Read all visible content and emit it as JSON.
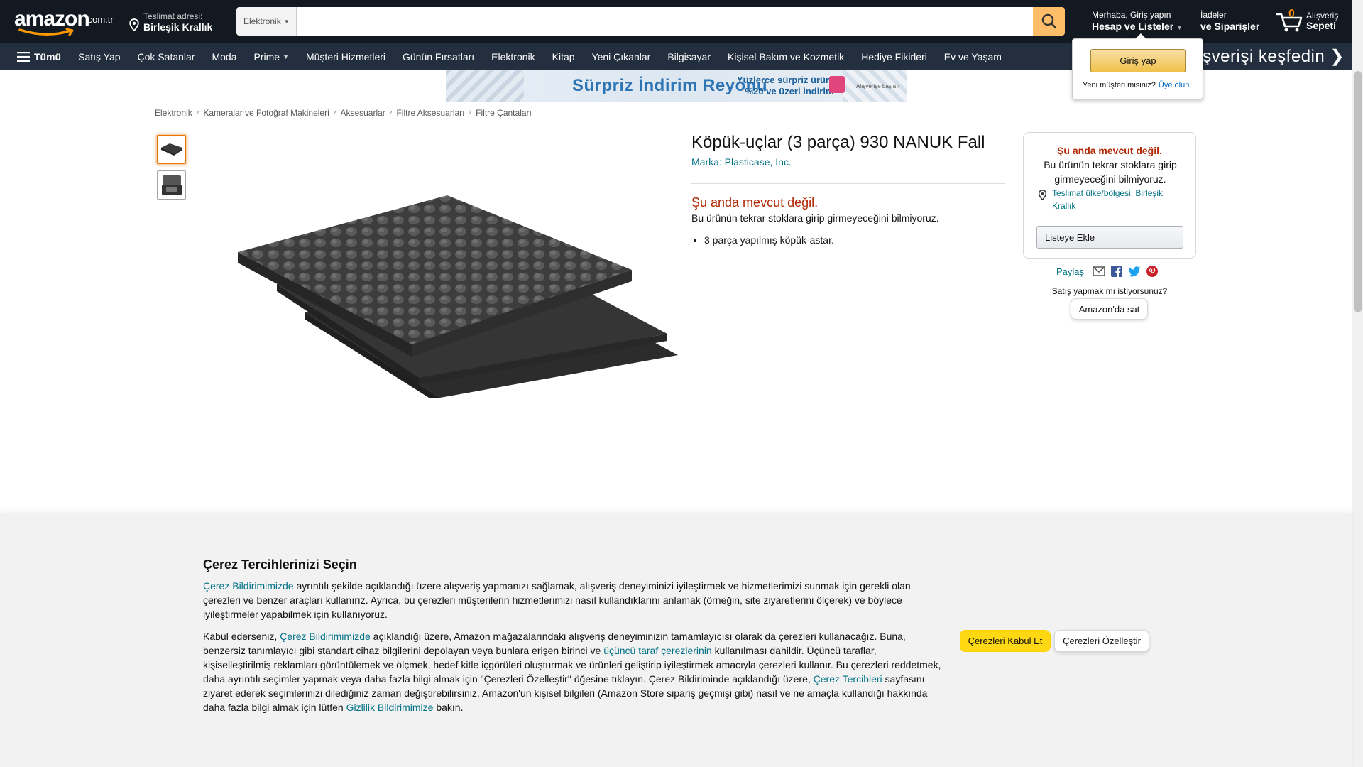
{
  "header": {
    "logo_text": "amazon",
    "logo_tld": ".com.tr",
    "deliver_label": "Teslimat adresi:",
    "deliver_location": "Birleşik Krallık",
    "search_category": "Elektronik",
    "search_value": "",
    "account_greeting": "Merhaba, Giriş yapın",
    "account_label": "Hesap ve Listeler",
    "orders_line1": "İadeler",
    "orders_line2": "ve Siparişler",
    "cart_count": "0",
    "cart_line1": "Alışveriş",
    "cart_line2": "Sepeti"
  },
  "nav": {
    "all_label": "Tümü",
    "items": [
      {
        "label": "Satış Yap"
      },
      {
        "label": "Çok Satanlar"
      },
      {
        "label": "Moda"
      },
      {
        "label": "Prime"
      },
      {
        "label": "Müşteri Hizmetleri"
      },
      {
        "label": "Günün Fırsatları"
      },
      {
        "label": "Elektronik"
      },
      {
        "label": "Kitap"
      },
      {
        "label": "Yeni Çıkanlar"
      },
      {
        "label": "Bilgisayar"
      },
      {
        "label": "Kişisel Bakım ve Kozmetik"
      },
      {
        "label": "Hediye Fikirleri"
      },
      {
        "label": "Ev ve Yaşam"
      }
    ],
    "promo_text": "alışverişi keşfedin ❯"
  },
  "signin_flyout": {
    "button_label": "Giriş yap",
    "new_customer_text": "Yeni müşteri misiniz?",
    "register_link": "Üye olun."
  },
  "banner": {
    "title": "Sürpriz İndirim Reyonu",
    "subtitle_line1": "Yüzlerce sürpriz üründe",
    "subtitle_line2": "%20 ve üzeri indirim",
    "small_text": "Alışverişe başla ›"
  },
  "breadcrumb": [
    "Elektronik",
    "Kameralar ve Fotoğraf Makineleri",
    "Aksesuarlar",
    "Filtre Aksesuarları",
    "Filtre Çantaları"
  ],
  "product": {
    "title": "Köpük-uçlar (3 parça) 930 NANUK Fall",
    "brand": "Marka: Plasticase, Inc.",
    "availability_title": "Şu anda mevcut değil.",
    "availability_text": "Bu ürünün tekrar stoklara girip girmeyeceğini bilmiyoruz.",
    "bullets": [
      "3 parça yapılmış köpük-astar."
    ]
  },
  "buybox": {
    "title": "Şu anda mevcut değil.",
    "text": "Bu ürünün tekrar stoklara girip girmeyeceğini bilmiyoruz.",
    "location_link": "Teslimat ülke/bölgesi: Birleşik Krallık",
    "list_button": "Listeye Ekle",
    "share_label": "Paylaş",
    "sell_question": "Satış yapmak mı istiyorsunuz?",
    "sell_button": "Amazon'da sat"
  },
  "cookie": {
    "title": "Çerez Tercihlerinizi Seçin",
    "p1_link": "Çerez Bildirimimizde",
    "p1_text": " ayrıntılı şekilde açıklandığı üzere alışveriş yapmanızı sağlamak, alışveriş deneyiminizi iyileştirmek ve hizmetlerimizi sunmak için gerekli olan çerezleri ve benzer araçları kullanırız. Ayrıca, bu çerezleri müşterilerin hizmetlerimizi nasıl kullandıklarını anlamak (örneğin, site ziyaretlerini ölçerek) ve böylece iyileştirmeler yapabilmek için kullanıyoruz.",
    "p2_a": "Kabul ederseniz, ",
    "p2_link1": "Çerez Bildirimimizde",
    "p2_b": " açıklandığı üzere, Amazon mağazalarındaki alışveriş deneyiminizin tamamlayıcısı olarak da çerezleri kullanacağız. Buna, benzersiz tanımlayıcı gibi standart cihaz bilgilerini depolayan veya bunlara erişen birinci ve ",
    "p2_link2": "üçüncü taraf çerezlerinin",
    "p2_c": " kullanılması dahildir. Üçüncü taraflar, kişiselleştirilmiş reklamları görüntülemek ve ölçmek, hedef kitle içgörüleri oluşturmak ve ürünleri geliştirip iyileştirmek amacıyla çerezleri kullanır. Bu çerezleri reddetmek, daha ayrıntılı seçimler yapmak veya daha fazla bilgi almak için \"Çerezleri Özelleştir\" öğesine tıklayın. Çerez Bildiriminde açıklandığı üzere, ",
    "p2_link3": "Çerez Tercihleri",
    "p2_d": " sayfasını ziyaret ederek seçimlerinizi dilediğiniz zaman değiştirebilirsiniz. Amazon'un kişisel bilgileri (Amazon Store sipariş geçmişi gibi) nasıl ve ne amaçla kullandığı hakkında daha fazla bilgi almak için lütfen ",
    "p2_link4": "Gizlilik Bildirimimize",
    "p2_e": " bakın.",
    "accept_button": "Çerezleri Kabul Et",
    "customize_button": "Çerezleri Özelleştir"
  },
  "colors": {
    "header_bg": "#131921",
    "nav_bg": "#232f3e",
    "search_button": "#febd69",
    "unavailable_red": "#b12704",
    "link_teal": "#007185",
    "accept_yellow": "#ffd814"
  }
}
